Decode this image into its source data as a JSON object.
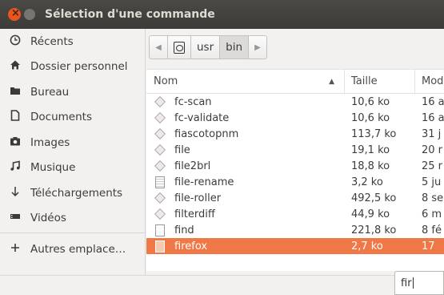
{
  "window": {
    "title": "Sélection d'une commande"
  },
  "sidebar": {
    "items": [
      {
        "label": "Récents",
        "icon": "clock-icon"
      },
      {
        "label": "Dossier personnel",
        "icon": "home-icon"
      },
      {
        "label": "Bureau",
        "icon": "folder-icon"
      },
      {
        "label": "Documents",
        "icon": "document-icon"
      },
      {
        "label": "Images",
        "icon": "camera-icon"
      },
      {
        "label": "Musique",
        "icon": "music-icon"
      },
      {
        "label": "Téléchargements",
        "icon": "download-icon"
      },
      {
        "label": "Vidéos",
        "icon": "film-icon"
      }
    ],
    "others_label": "Autres emplace…"
  },
  "pathbar": {
    "segments": [
      "usr",
      "bin"
    ],
    "active": "bin"
  },
  "filelist": {
    "headers": {
      "name": "Nom",
      "size": "Taille",
      "modified": "Mod"
    },
    "rows": [
      {
        "name": "fc-scan",
        "size": "10,6 ko",
        "modified": "16 a",
        "icon": "executable-icon"
      },
      {
        "name": "fc-validate",
        "size": "10,6 ko",
        "modified": "16 a",
        "icon": "executable-icon"
      },
      {
        "name": "fiascotopnm",
        "size": "113,7 ko",
        "modified": "31 j",
        "icon": "executable-icon"
      },
      {
        "name": "file",
        "size": "19,1 ko",
        "modified": "20 r",
        "icon": "executable-icon"
      },
      {
        "name": "file2brl",
        "size": "18,8 ko",
        "modified": "25 r",
        "icon": "executable-icon"
      },
      {
        "name": "file-rename",
        "size": "3,2 ko",
        "modified": "5 ju",
        "icon": "script-icon"
      },
      {
        "name": "file-roller",
        "size": "492,5 ko",
        "modified": "8 se",
        "icon": "executable-icon"
      },
      {
        "name": "filterdiff",
        "size": "44,9 ko",
        "modified": "6 m",
        "icon": "executable-icon"
      },
      {
        "name": "find",
        "size": "221,8 ko",
        "modified": "8 fé",
        "icon": "text-file-icon"
      },
      {
        "name": "firefox",
        "size": "2,7 ko",
        "modified": "17",
        "icon": "script-icon",
        "selected": true
      }
    ]
  },
  "typeahead": {
    "value": "fir"
  },
  "colors": {
    "titlebar": "#3c3b37",
    "selection": "#f07746",
    "close_button": "#e9541f"
  }
}
